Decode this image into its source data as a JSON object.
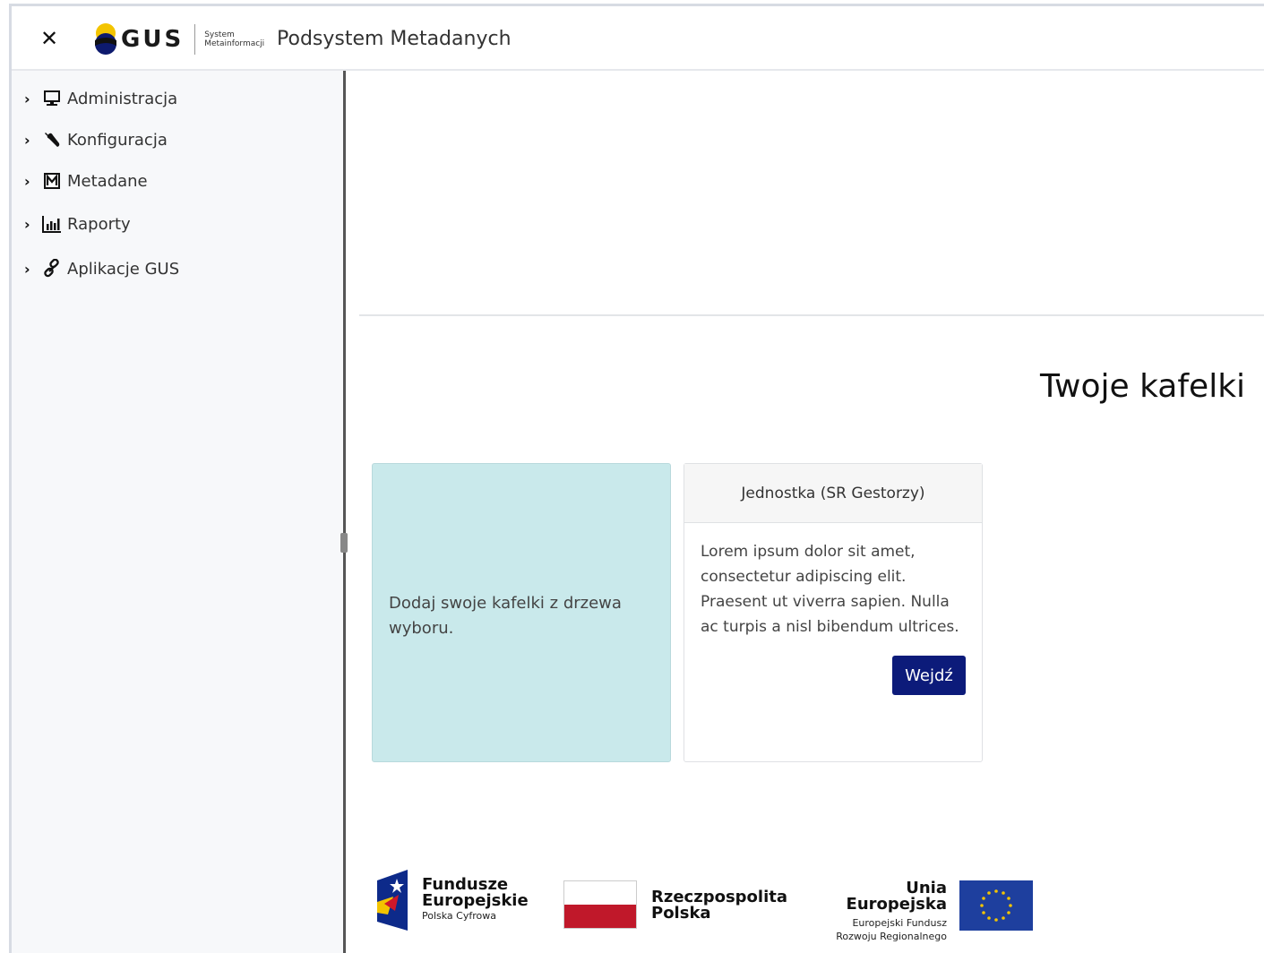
{
  "header": {
    "close_icon": "close-icon",
    "logo_text": "GUS",
    "logo_sub": "System Metainformacji",
    "app_title": "Podsystem Metadanych"
  },
  "sidebar": {
    "items": [
      {
        "label": "Administracja",
        "icon": "monitor-icon"
      },
      {
        "label": "Konfiguracja",
        "icon": "wrench-icon"
      },
      {
        "label": "Metadane",
        "icon": "m-box-icon"
      },
      {
        "label": "Raporty",
        "icon": "bar-chart-icon"
      },
      {
        "label": "Aplikacje GUS",
        "icon": "link-icon"
      }
    ]
  },
  "main": {
    "page_title": "Twoje kafelki",
    "add_tile_text": "Dodaj swoje kafelki z drzewa wyboru.",
    "card": {
      "title": "Jednostka (SR Gestorzy)",
      "body": "Lorem ipsum dolor sit amet, consectetur adipiscing elit. Praesent ut viverra sapien. Nulla ac turpis a nisl bibendum ultrices.",
      "button_label": "Wejdź"
    }
  },
  "footer": {
    "fe_line1": "Fundusze",
    "fe_line2": "Europejskie",
    "fe_sub": "Polska Cyfrowa",
    "pl_line1": "Rzeczpospolita",
    "pl_line2": "Polska",
    "eu_title": "Unia Europejska",
    "eu_sub1": "Europejski Fundusz",
    "eu_sub2": "Rozwoju Regionalnego"
  },
  "colors": {
    "accent_button": "#0c1b7a",
    "add_tile_bg": "#c9e9eb",
    "pl_red": "#c0182a",
    "eu_blue": "#1e3f9e"
  }
}
